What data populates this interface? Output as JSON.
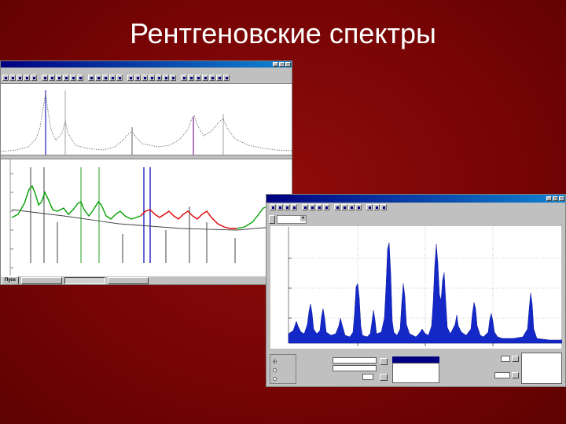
{
  "slide": {
    "title": "Рентгеновские спектры"
  },
  "window1": {
    "title": "",
    "menu": [
      "",
      "",
      "",
      "",
      ""
    ],
    "taskbar": {
      "start": "Пуск",
      "tasks": [
        "",
        "",
        ""
      ],
      "status": ""
    }
  },
  "window2": {
    "title": "",
    "tabs": [
      ""
    ],
    "combo": "",
    "panel": {
      "group_title": "",
      "radios": [
        "",
        "",
        ""
      ],
      "label_a": "",
      "label_b": "",
      "label_c": "",
      "field_a": "",
      "field_b": "",
      "field_c": "",
      "label_d": "",
      "label_e": "",
      "field_d": "",
      "field_e": "",
      "selected_item": ""
    }
  },
  "colors": {
    "background": "#760404",
    "title_text": "#ffffff",
    "spectrum_blue": "#1428c8",
    "fit_red": "#e00000",
    "fit_green": "#00a000",
    "window_face": "#c0c0c0",
    "titlebar": "#000080"
  },
  "icons": [
    "window-close-icon",
    "window-maximize-icon",
    "window-minimize-icon",
    "toolbar-icon"
  ]
}
